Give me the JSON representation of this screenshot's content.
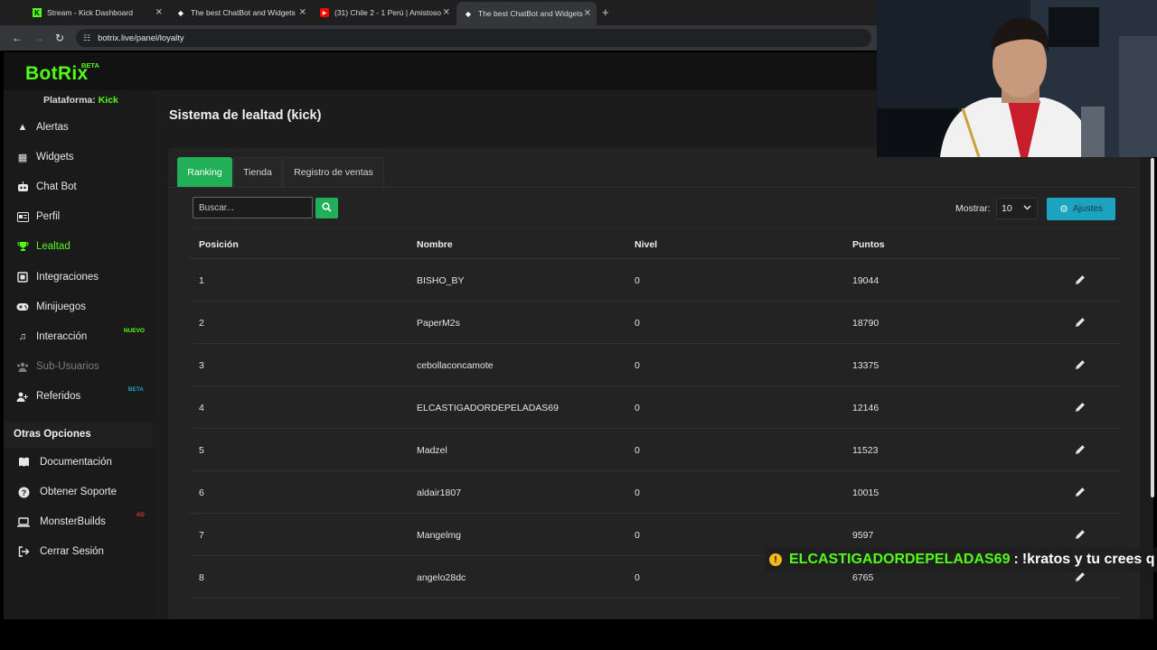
{
  "browser": {
    "tabs": [
      {
        "title": "Stream - Kick Dashboard",
        "icon": "kick-icon",
        "active": false
      },
      {
        "title": "The best ChatBot and Widgets",
        "icon": "botrix-icon",
        "active": false
      },
      {
        "title": "(31) Chile 2 - 1 Perú | Amistoso",
        "icon": "youtube-icon",
        "active": false
      },
      {
        "title": "The best ChatBot and Widgets",
        "icon": "botrix-icon",
        "active": true
      }
    ],
    "url": "botrix.live/panel/loyalty"
  },
  "app": {
    "logo": "BotRix",
    "logo_badge": "BETA",
    "platform_label": "Plataforma:",
    "platform_value": "Kick"
  },
  "sidebar": {
    "items": [
      {
        "label": "Alertas",
        "icon": "warning-icon",
        "state": "normal",
        "badge": ""
      },
      {
        "label": "Widgets",
        "icon": "grid-icon",
        "state": "normal",
        "badge": ""
      },
      {
        "label": "Chat Bot",
        "icon": "robot-icon",
        "state": "normal",
        "badge": ""
      },
      {
        "label": "Perfil",
        "icon": "id-card-icon",
        "state": "normal",
        "badge": ""
      },
      {
        "label": "Lealtad",
        "icon": "trophy-icon",
        "state": "active",
        "badge": ""
      },
      {
        "label": "Integraciones",
        "icon": "puzzle-icon",
        "state": "normal",
        "badge": ""
      },
      {
        "label": "Minijuegos",
        "icon": "gamepad-icon",
        "state": "normal",
        "badge": ""
      },
      {
        "label": "Interacción",
        "icon": "music-icon",
        "state": "normal",
        "badge": "NUEVO"
      },
      {
        "label": "Sub-Usuarios",
        "icon": "users-icon",
        "state": "disabled",
        "badge": ""
      },
      {
        "label": "Referidos",
        "icon": "user-plus-icon",
        "state": "normal",
        "badge": "BETA"
      }
    ],
    "other_header": "Otras Opciones",
    "other_items": [
      {
        "label": "Documentación",
        "icon": "book-icon",
        "badge": ""
      },
      {
        "label": "Obtener Soporte",
        "icon": "question-icon",
        "badge": ""
      },
      {
        "label": "MonsterBuilds",
        "icon": "laptop-icon",
        "badge": "AD"
      },
      {
        "label": "Cerrar Sesión",
        "icon": "sign-out-icon",
        "badge": ""
      }
    ],
    "colors": {
      "accent": "#53fc18",
      "nuevo": "#53fc18",
      "beta": "#1ba3bf",
      "ad": "#d9332b"
    }
  },
  "main": {
    "title": "Sistema de lealtad (kick)",
    "tabs": [
      {
        "label": "Ranking",
        "active": true
      },
      {
        "label": "Tienda",
        "active": false
      },
      {
        "label": "Registro de ventas",
        "active": false
      }
    ],
    "search": {
      "placeholder": "Buscar...",
      "value": ""
    },
    "show_label": "Mostrar:",
    "show_value": "10",
    "settings_label": "Ajustes",
    "table": {
      "headers": [
        "Posición",
        "Nombre",
        "Nivel",
        "Puntos"
      ],
      "rows": [
        {
          "pos": "1",
          "name": "BISHO_BY",
          "level": "0",
          "points": "19044"
        },
        {
          "pos": "2",
          "name": "PaperM2s",
          "level": "0",
          "points": "18790"
        },
        {
          "pos": "3",
          "name": "cebollaconcamote",
          "level": "0",
          "points": "13375"
        },
        {
          "pos": "4",
          "name": "ELCASTIGADORDEPELADAS69",
          "level": "0",
          "points": "12146"
        },
        {
          "pos": "5",
          "name": "Madzel",
          "level": "0",
          "points": "11523"
        },
        {
          "pos": "6",
          "name": "aldair1807",
          "level": "0",
          "points": "10015"
        },
        {
          "pos": "7",
          "name": "Mangelmg",
          "level": "0",
          "points": "9597"
        },
        {
          "pos": "8",
          "name": "angelo28dc",
          "level": "0",
          "points": "6765"
        }
      ]
    },
    "colors": {
      "primary": "#21b057",
      "info": "#1ba3bf"
    }
  },
  "chat_overlay": {
    "user": "ELCASTIGADORDEPELADAS69",
    "separator": ":",
    "message": "!kratos y tu crees q"
  }
}
